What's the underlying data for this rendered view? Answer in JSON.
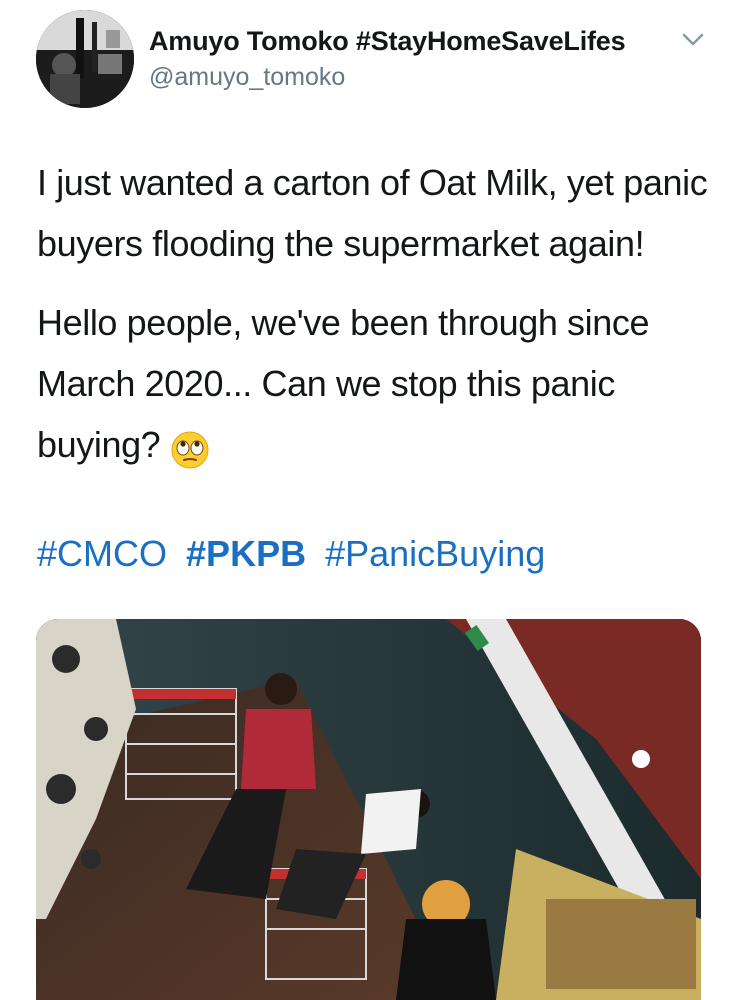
{
  "tweet": {
    "author": {
      "display_name": "Amuyo Tomoko #StayHomeSaveLifes",
      "handle": "@amuyo_tomoko"
    },
    "menu_icon": "chevron-down-icon",
    "paragraphs": [
      "I just wanted a carton of Oat Milk, yet panic buyers flooding the supermarket again!",
      "Hello people, we've been through since March 2020... Can we stop this panic buying?"
    ],
    "emoji": "rolling-eyes-emoji",
    "hashtags": [
      {
        "text": "#CMCO",
        "bold": false
      },
      {
        "text": "#PKPB",
        "bold": true
      },
      {
        "text": "#PanicBuying",
        "bold": false
      }
    ],
    "colors": {
      "text": "#14171a",
      "secondary": "#657786",
      "link": "#1b6fc3"
    }
  }
}
